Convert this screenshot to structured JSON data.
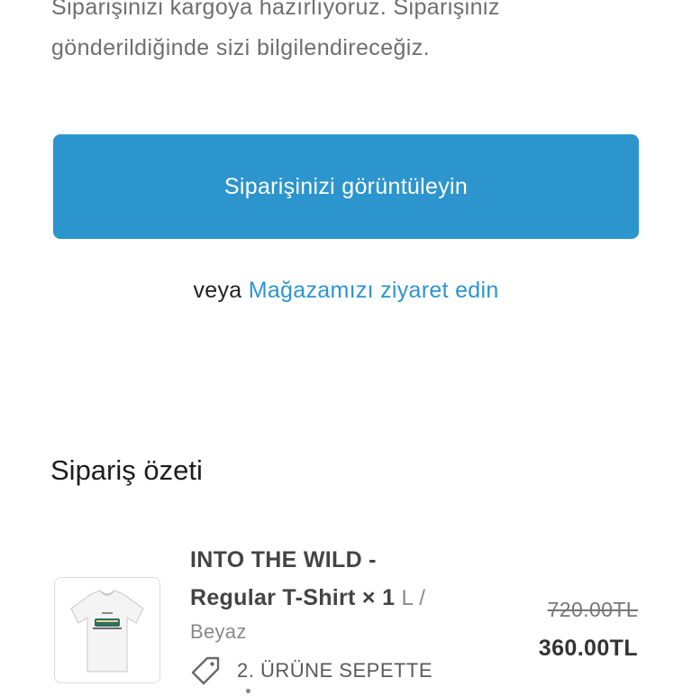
{
  "intro": {
    "line1": "Siparişinizi kargoya hazırlıyoruz. Siparişiniz",
    "line2": "gönderildiğinde sizi bilgilendireceğiz."
  },
  "cta": {
    "view_order_label": "Siparişinizi görüntüleyin"
  },
  "alt_action": {
    "or_text": "veya",
    "visit_store_label": "Mağazamızı ziyaret edin"
  },
  "summary": {
    "title": "Sipariş özeti",
    "items": [
      {
        "name_line1": "INTO THE WILD -",
        "name_line2": "Regular T-Shirt × 1",
        "variant": "L /",
        "color": "Beyaz",
        "discount_label": "2. ÜRÜNE SEPETTE",
        "original_price": "720.00TL",
        "price": "360.00TL",
        "thumbnail_icon": "white-tshirt-image"
      }
    ]
  },
  "colors": {
    "accent": "#2c95ce",
    "text_muted": "#6f6f6f",
    "text_dark": "#222222"
  }
}
